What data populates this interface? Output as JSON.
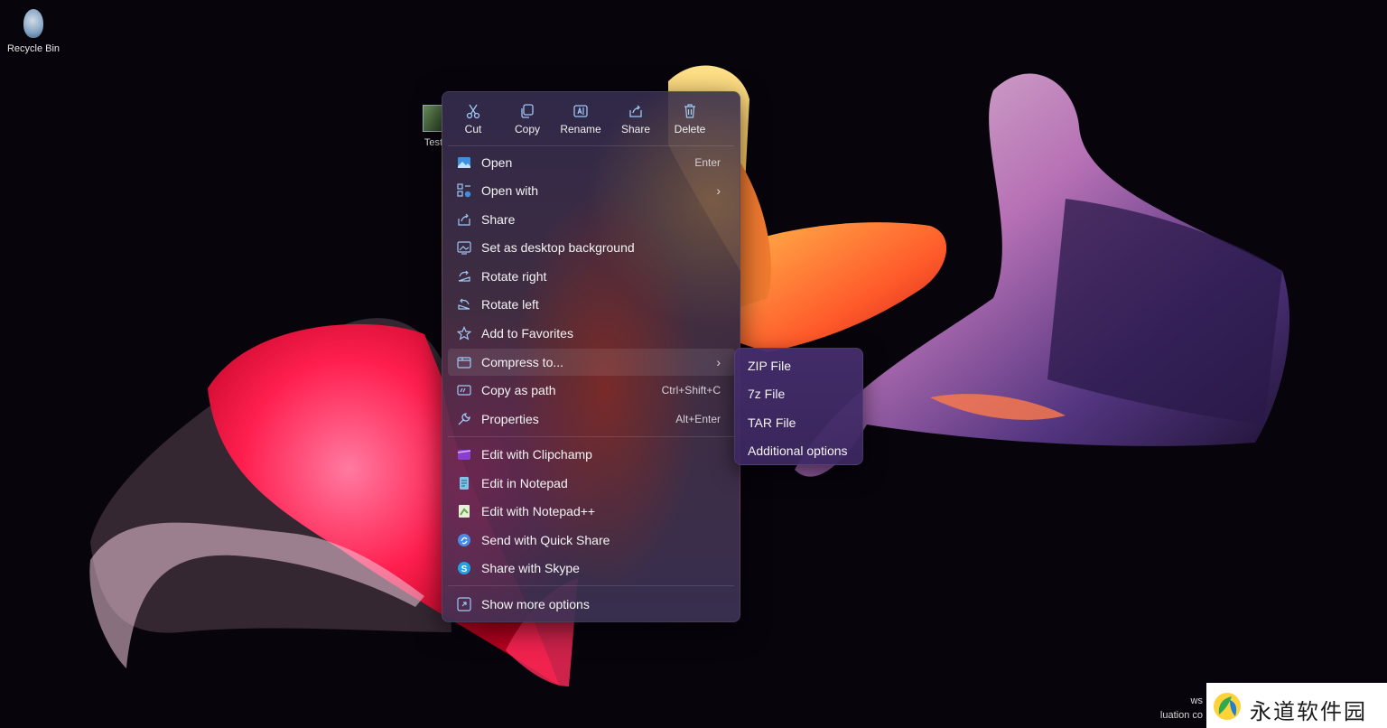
{
  "desktop": {
    "recycle_bin_label": "Recycle Bin",
    "file_label": "Test"
  },
  "menu": {
    "top_actions": [
      {
        "label": "Cut",
        "icon": "scissors-icon"
      },
      {
        "label": "Copy",
        "icon": "copy-icon"
      },
      {
        "label": "Rename",
        "icon": "rename-icon"
      },
      {
        "label": "Share",
        "icon": "share-icon"
      },
      {
        "label": "Delete",
        "icon": "trash-icon"
      }
    ],
    "items": [
      {
        "label": "Open",
        "shortcut": "Enter",
        "icon": "image-icon"
      },
      {
        "label": "Open with",
        "icon": "apps-icon",
        "has_submenu": true
      },
      {
        "label": "Share",
        "icon": "share-icon"
      },
      {
        "label": "Set as desktop background",
        "icon": "desktop-background-icon"
      },
      {
        "label": "Rotate right",
        "icon": "rotate-right-icon"
      },
      {
        "label": "Rotate left",
        "icon": "rotate-left-icon"
      },
      {
        "label": "Add to Favorites",
        "icon": "star-icon"
      },
      {
        "label": "Compress to...",
        "icon": "archive-icon",
        "has_submenu": true,
        "highlighted": true
      },
      {
        "label": "Copy as path",
        "shortcut": "Ctrl+Shift+C",
        "icon": "path-icon"
      },
      {
        "label": "Properties",
        "shortcut": "Alt+Enter",
        "icon": "wrench-icon"
      }
    ],
    "app_items": [
      {
        "label": "Edit with Clipchamp",
        "icon": "clipchamp-icon"
      },
      {
        "label": "Edit in Notepad",
        "icon": "notepad-icon"
      },
      {
        "label": "Edit with Notepad++",
        "icon": "notepad-plus-plus-icon"
      },
      {
        "label": "Send with Quick Share",
        "icon": "quick-share-icon"
      },
      {
        "label": "Share with Skype",
        "icon": "skype-icon"
      }
    ],
    "more_label": "Show more options"
  },
  "submenu": {
    "items": [
      "ZIP File",
      "7z File",
      "TAR File",
      "Additional options"
    ]
  },
  "system": {
    "eval_line1": "ws",
    "eval_line2": "luation co"
  },
  "watermark": {
    "text": "永道软件园"
  },
  "colors": {
    "menu_bg": "#342c4e",
    "submenu_bg": "#462e6e",
    "accent_blue": "#4aa3f0"
  }
}
